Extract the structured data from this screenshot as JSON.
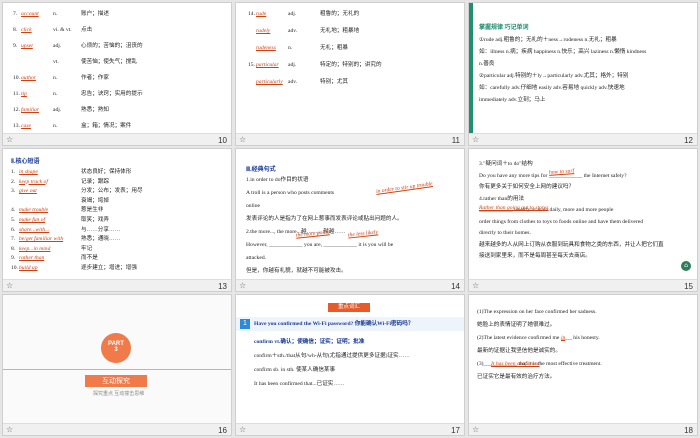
{
  "slides": [
    {
      "num": "10",
      "rows": [
        {
          "n": "7.",
          "a": "account",
          "t": "n.",
          "m": "账户；描述"
        },
        {
          "n": "8.",
          "a": "click",
          "t": "vi. & vt.",
          "m": "点击"
        },
        {
          "n": "9.",
          "a": "upset",
          "t": "adj.",
          "m": "心烦的；苦恼的；沮丧的"
        },
        {
          "n": "",
          "a": "",
          "t": "vt.",
          "m": "使苦恼；使失气；搅乱"
        },
        {
          "n": "10.",
          "a": "author",
          "t": "n.",
          "m": "作者；作家"
        },
        {
          "n": "11.",
          "a": "tip",
          "t": "n.",
          "m": "忠告；诀窍；实用的提示"
        },
        {
          "n": "12.",
          "a": "familiar",
          "t": "adj.",
          "m": "熟悉；熟知"
        },
        {
          "n": "13.",
          "a": "case",
          "t": "n.",
          "m": "盒；箱；情况；案件"
        }
      ]
    },
    {
      "num": "11",
      "rows": [
        {
          "n": "14.",
          "a": "rude",
          "t": "adj.",
          "m": "粗鲁的；无礼的"
        },
        {
          "n": "",
          "a": "rudely",
          "t": "adv.",
          "m": "无礼地；粗暴地"
        },
        {
          "n": "",
          "a": "rudeness",
          "t": "n.",
          "m": "无礼；粗暴"
        },
        {
          "n": "15.",
          "a": "particular",
          "t": "adj.",
          "m": "特定的；特别的；讲究的"
        },
        {
          "n": "",
          "a": "particularly",
          "t": "adv.",
          "m": "特别；尤其"
        }
      ]
    },
    {
      "num": "12",
      "title": "掌握规律  巧记单词",
      "lines": [
        "①rude adj.粗鲁的；无礼的＋ness→rudeness n.无礼；粗暴",
        "如：illness n.病；疾病  happiness n.快乐；高兴  laziness n.懒惰  kindness",
        "n.善良",
        "②particular adj.特别的＋ly→particularly adv.尤其；格外；特别",
        "如：carefully adv.仔细地  easily adv.容易地  quickly adv.快速地",
        "immediately adv.立刻；马上"
      ]
    },
    {
      "num": "13",
      "title": "Ⅱ.核心短语",
      "rows": [
        {
          "n": "1.",
          "a": "in shape",
          "m": "状态良好；保持体形"
        },
        {
          "n": "2.",
          "a": "keep track of",
          "m": "记录；跟踪"
        },
        {
          "n": "3.",
          "a": "give out",
          "m": "分发；公布；发表；用尽"
        },
        {
          "n": "",
          "a": "",
          "m": "衰竭；垮掉"
        },
        {
          "n": "4.",
          "a": "make trouble",
          "m": "惹是生非"
        },
        {
          "n": "5.",
          "a": "make fun of",
          "m": "取笑；戏弄"
        },
        {
          "n": "6.",
          "a": "share...with...",
          "m": "与……分享……"
        },
        {
          "n": "7.",
          "a": "be/get familiar with",
          "m": "熟悉；通晓……"
        },
        {
          "n": "8.",
          "a": "keep...in mind",
          "m": "牢记"
        },
        {
          "n": "9.",
          "a": "rather than",
          "m": "而不是"
        },
        {
          "n": "10.",
          "a": "build up",
          "m": "逐步建立；增进；增强"
        }
      ]
    },
    {
      "num": "14",
      "title": "Ⅲ.经典句式",
      "lines": [
        "1.in order to do作目的状语",
        "A troll is a person who posts comments",
        "online",
        "发表评论的人是指为了在网上惹事而发表评论或贴出问题的人。",
        "2.the more..., the more...越……，就越……",
        "However, ____________ you are, ____________ it is you will be",
        "attacked.",
        "但是，你越有礼貌，就越不可能被攻击。"
      ],
      "blanks": [
        "in order to stir up trouble",
        "the more polite",
        "the less likely"
      ]
    },
    {
      "num": "15",
      "lines": [
        "3.\"疑问词＋to do\"结构",
        "Do you have any more tips for ____________ the Internet safely?",
        "你有更多关于如何安全上网的建议吗？",
        "4.rather than的用法",
        "____________ weekly or even daily, more and more people",
        "order things from clothes to toys to foods online and have them delivered",
        "directly to their homes.",
        "越来越多的人从网上订购从衣服到玩具和食物之类的东西，并让人把它们直",
        "接送到家里来，而不是每周甚至每天去商店。"
      ],
      "blanks": [
        "how to surf",
        "Rather than going out to stores"
      ]
    },
    {
      "num": "16",
      "part": "PART",
      "partnum": "3",
      "label": "互动探究",
      "sub": "探究重点  互动撞击思维"
    },
    {
      "num": "17",
      "tag": "重点词汇",
      "idx": "1",
      "head": "Have you confirmed the Wi-Fi password? 你能确认Wi-Fi密码吗？",
      "lines": [
        "confirm vt.确认；使确信；证实；证明；批准",
        "confirm＋sth./that从句/wh-从句(尤指通过提供更多证据)证实……",
        "confirm sb. in sth. 使某人确信某事",
        "It has been confirmed that...已证实……"
      ]
    },
    {
      "num": "18",
      "lines": [
        "(1)The expression on her face confirmed her sadness.",
        "她脸上的表情证明了她很难过。",
        "(2)The latest evidence confirmed me ____ his honesty.",
        "最新的证据让我坚信他是诚实的。",
        "(3)____________ that it is the most effective treatment.",
        "已证实它是最有效的治疗方法。"
      ],
      "blanks": [
        "in",
        "It has been confirmed"
      ]
    }
  ]
}
